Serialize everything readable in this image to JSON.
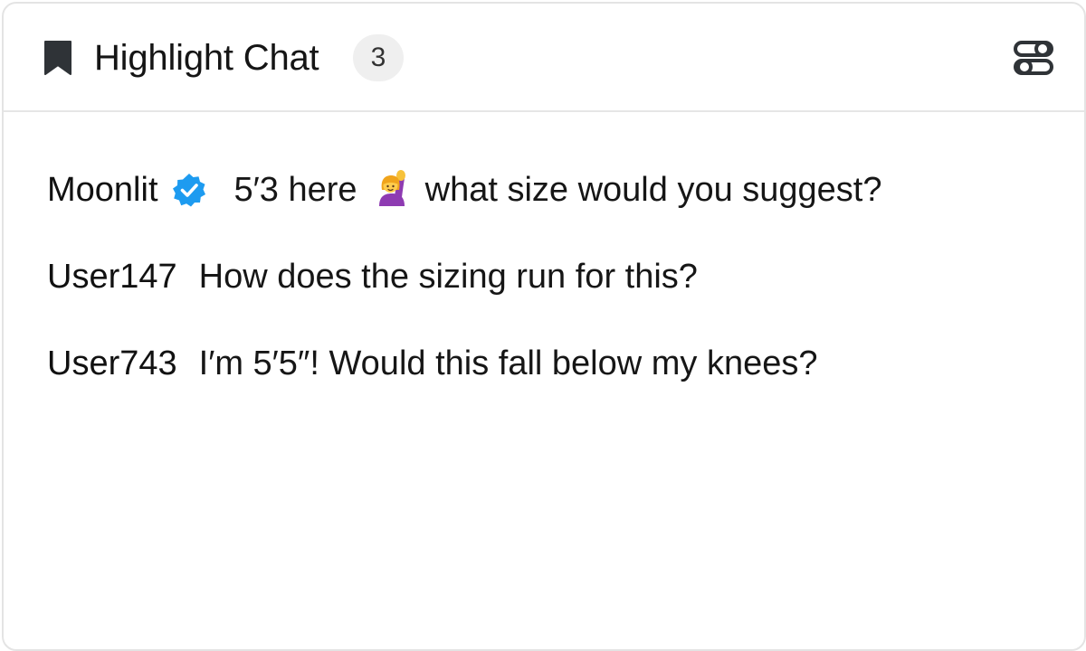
{
  "header": {
    "title": "Highlight Chat",
    "count": "3",
    "icons": {
      "left": "bookmark-icon",
      "right": "settings-toggle-icon"
    }
  },
  "messages": [
    {
      "user": "Moonlit",
      "verified": true,
      "text_before_emoji": "5′3 here",
      "emoji": "raising-hand-emoji",
      "text_after_emoji": "what size would you suggest?"
    },
    {
      "user": "User147",
      "verified": false,
      "text": "How does the sizing run for this?"
    },
    {
      "user": "User743",
      "verified": false,
      "text": "I′m 5′5″! Would this fall below my knees?"
    }
  ],
  "colors": {
    "border": "#e4e4e4",
    "divider": "#e6e6e6",
    "badge_bg": "#efefef",
    "verified_blue": "#1d9bf0",
    "icon_dark": "#2f3337"
  }
}
